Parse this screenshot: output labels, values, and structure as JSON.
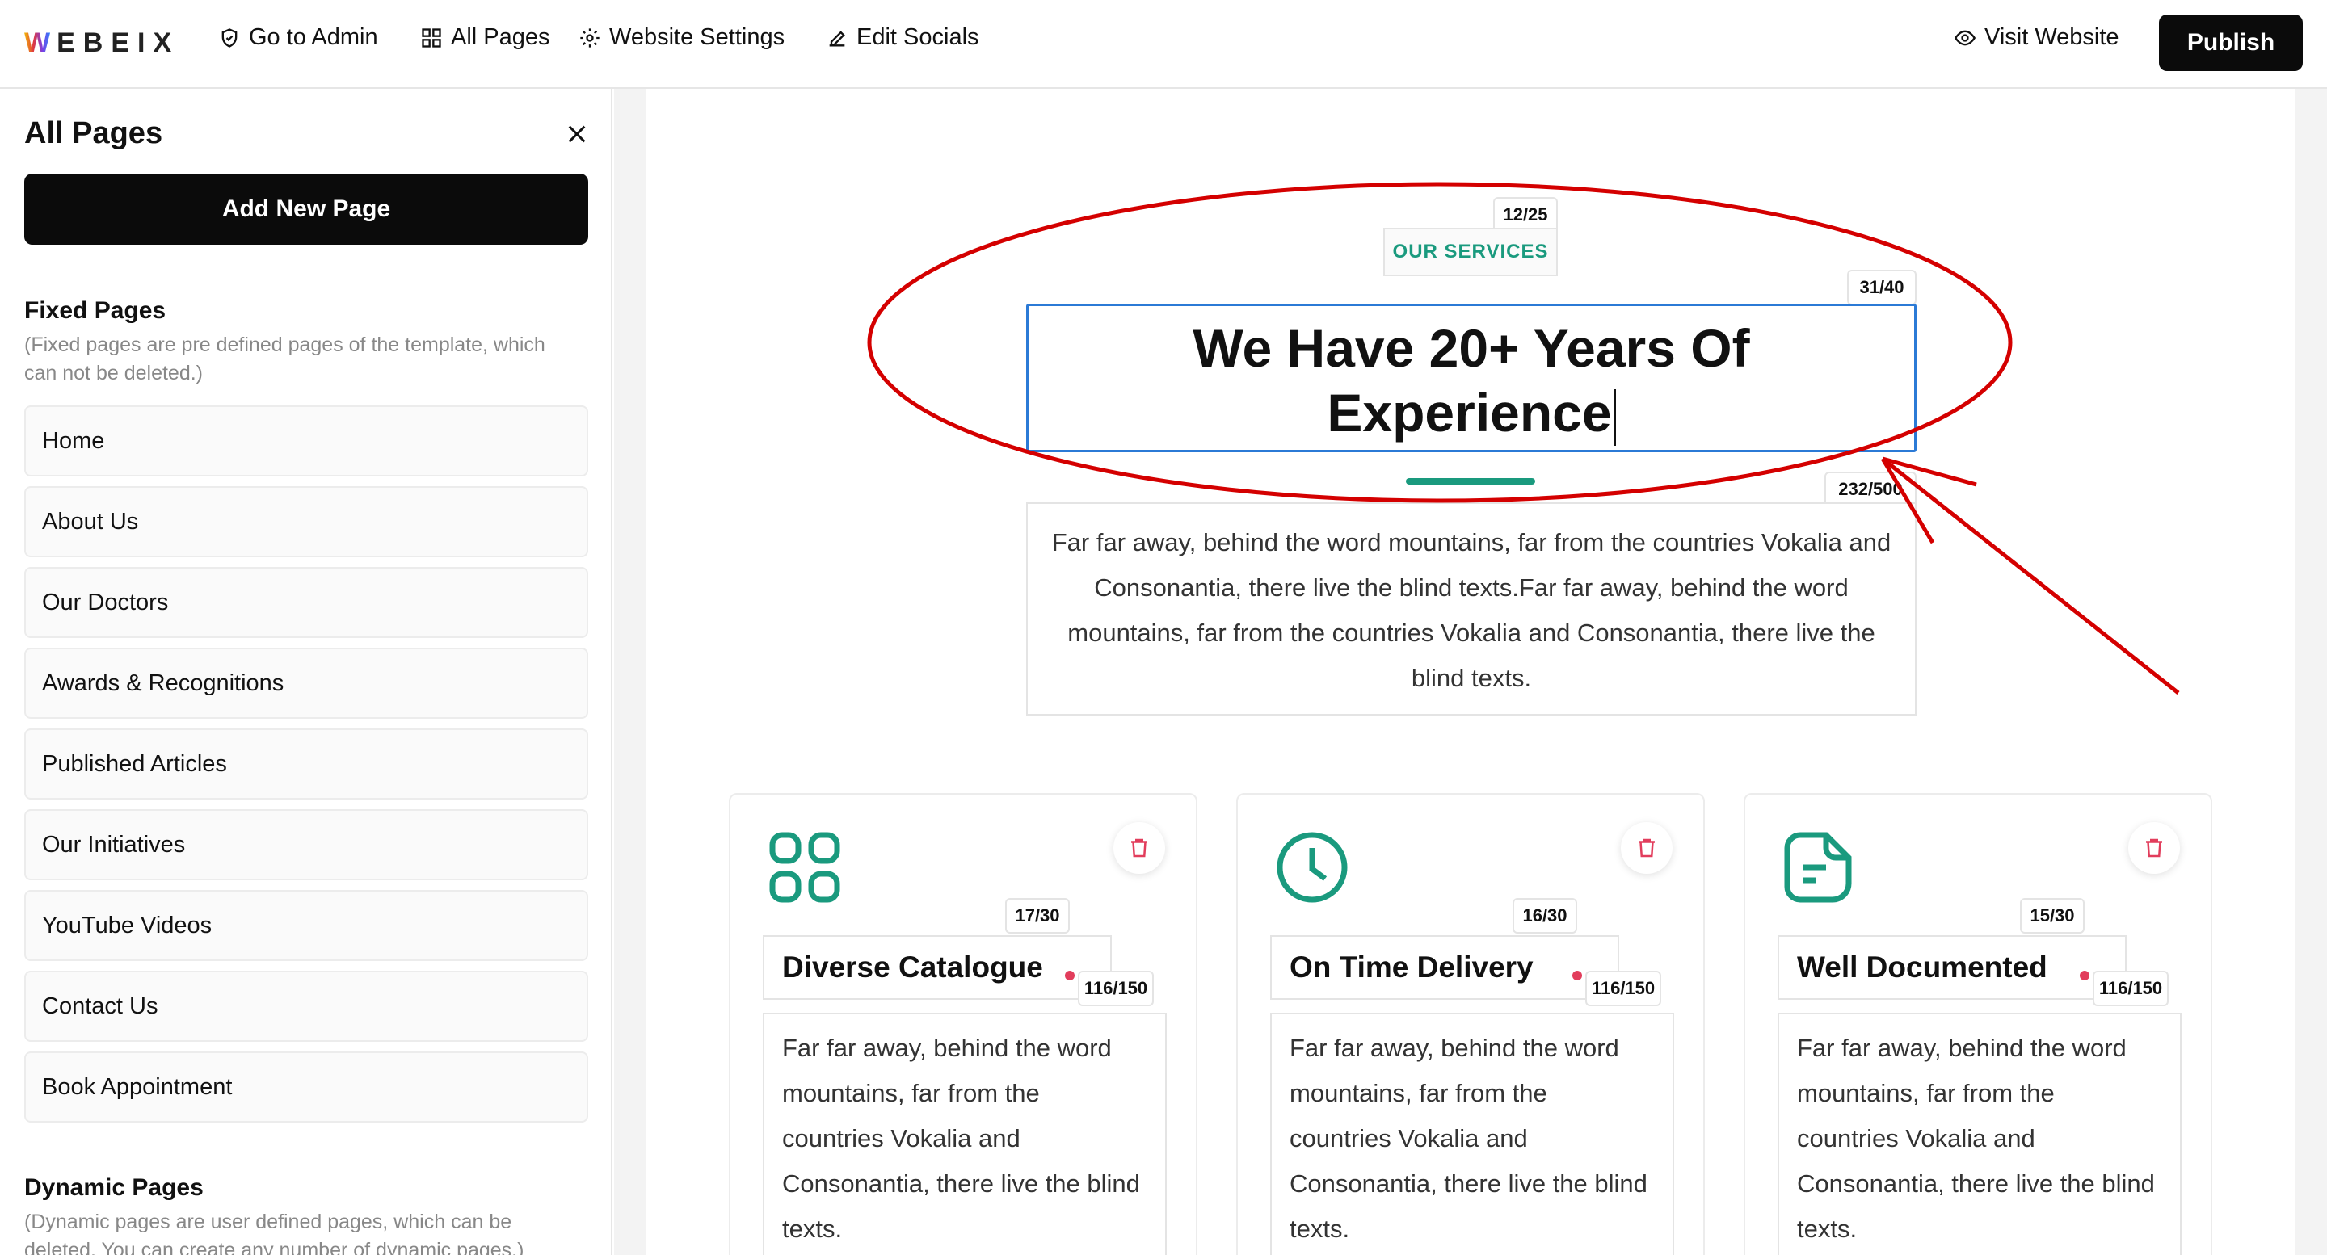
{
  "brand": {
    "logo_initial": "W",
    "logo_rest": "EBEIX"
  },
  "topbar": {
    "go_to_admin": "Go to Admin",
    "all_pages": "All Pages",
    "website_settings": "Website Settings",
    "edit_socials": "Edit Socials",
    "visit_website": "Visit Website",
    "publish": "Publish"
  },
  "sidebar": {
    "title": "All Pages",
    "add_new_page": "Add New Page",
    "fixed_title": "Fixed Pages",
    "fixed_note": "(Fixed pages are pre defined pages of the template, which can not be deleted.)",
    "fixed_pages": [
      "Home",
      "About Us",
      "Our Doctors",
      "Awards & Recognitions",
      "Published Articles",
      "Our Initiatives",
      "YouTube Videos",
      "Contact Us",
      "Book Appointment"
    ],
    "dynamic_title": "Dynamic Pages",
    "dynamic_note": "(Dynamic pages are user defined pages, which can be deleted. You can create any number of dynamic pages.)"
  },
  "section": {
    "badge": "OUR SERVICES",
    "badge_counter": "12/25",
    "headline_line1": "We Have 20+ Years Of",
    "headline_line2": "Experience",
    "headline_counter": "31/40",
    "desc_counter": "232/500",
    "description": "Far far away, behind the word mountains, far from the countries Vokalia and Consonantia, there live the blind texts.Far far away, behind the word mountains, far from the countries Vokalia and Consonantia, there live the blind texts."
  },
  "cards": [
    {
      "icon": "grid-icon",
      "title": "Diverse Catalogue",
      "title_counter": "17/30",
      "body_counter": "116/150",
      "body": "Far far away, behind the word mountains, far from the countries Vokalia and Consonantia, there live the blind texts."
    },
    {
      "icon": "clock-icon",
      "title": "On Time Delivery",
      "title_counter": "16/30",
      "body_counter": "116/150",
      "body": "Far far away, behind the word mountains, far from the countries Vokalia and Consonantia, there live the blind texts."
    },
    {
      "icon": "document-icon",
      "title": "Well Documented",
      "title_counter": "15/30",
      "body_counter": "116/150",
      "body": "Far far away, behind the word mountains, far from the countries Vokalia and Consonantia, there live the blind texts."
    }
  ],
  "colors": {
    "accent": "#1a9a7e",
    "focus_border": "#2b7ad6",
    "annotation": "#d40000",
    "delete": "#e23d5c"
  }
}
